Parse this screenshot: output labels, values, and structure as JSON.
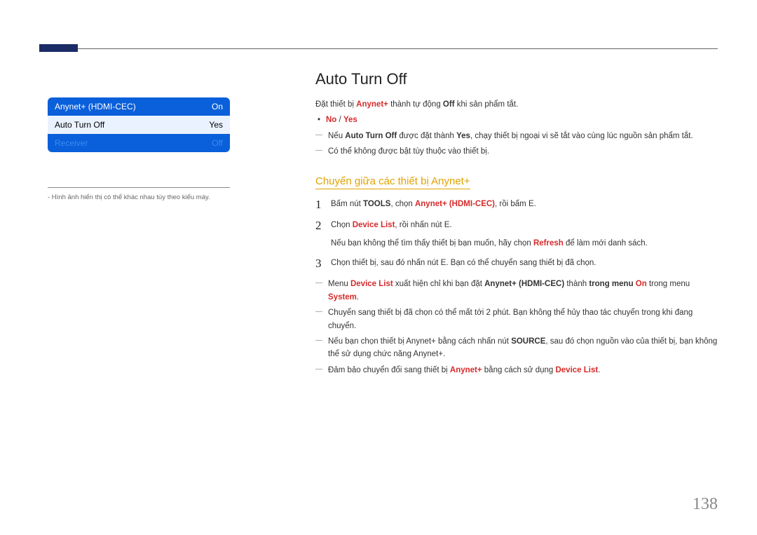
{
  "menu": {
    "row1": {
      "label": "Anynet+ (HDMI-CEC)",
      "value": "On"
    },
    "row2": {
      "label": "Auto Turn Off",
      "value": "Yes"
    },
    "row3": {
      "label": "Receiver",
      "value": "Off"
    }
  },
  "footnote": "- Hình ảnh hiển thị có thể khác nhau tùy theo kiểu máy.",
  "heading": "Auto Turn Off",
  "intro": {
    "pre": "Đặt thiết bị ",
    "k1": "Anynet+",
    "mid": " thành tự động ",
    "k2": "Off",
    "post": " khi sản phẩm tắt."
  },
  "bullet1": {
    "a": "No",
    "sep": " / ",
    "b": "Yes"
  },
  "note1": {
    "pre": "Nếu ",
    "k1": "Auto Turn Off",
    "mid1": " được đặt thành ",
    "k2": "Yes",
    "post": ", chạy thiết bị ngoại vi sẽ tắt vào cùng lúc nguồn sản phẩm tắt."
  },
  "note2": "Có thể không được bật tùy thuộc vào thiết bị.",
  "h2": "Chuyển giữa các thiết bị Anynet+",
  "step1": {
    "num": "1",
    "t1": "Bấm nút ",
    "k1": "TOOLS",
    "t2": ", chọn ",
    "k2": "Anynet+ (HDMI-CEC)",
    "t3": ", rồi bấm ",
    "k3": "E",
    "t4": "."
  },
  "step2": {
    "num": "2",
    "t1": "Chọn ",
    "k1": "Device List",
    "t2": ", rồi nhấn nút ",
    "k2": "E",
    "t3": ".",
    "sub1a": "Nếu bạn không thể tìm thấy thiết bị bạn muốn, hãy chọn ",
    "sub1k": "Refresh",
    "sub1b": " để làm mới danh sách."
  },
  "step3": {
    "num": "3",
    "t1": "Chọn thiết bị, sau đó nhấn nút ",
    "k1": "E",
    "t2": ". Bạn có thể chuyển sang thiết bị đã chọn."
  },
  "bnote1": {
    "a": "Menu ",
    "k1": "Device List",
    "b": " xuất hiện chỉ khi bạn đặt ",
    "k2": "Anynet+ (HDMI-CEC)",
    "c": " thành ",
    "k3": "On",
    "d": " trong menu ",
    "k4": "System",
    "e": "."
  },
  "bnote2": "Chuyển sang thiết bị đã chọn có thể mất tới 2 phút. Bạn không thể hủy thao tác chuyển trong khi đang chuyển.",
  "bnote3": {
    "a": "Nếu bạn chọn thiết bị Anynet+ bằng cách nhấn nút ",
    "k1": "SOURCE",
    "b": ", sau đó chọn nguồn vào của thiết bị, bạn không thể sử dụng chức năng Anynet+."
  },
  "bnote4": {
    "a": "Đảm bảo chuyển đổi sang thiết bị ",
    "k1": "Anynet+",
    "b": " bằng cách sử dụng ",
    "k2": "Device List",
    "c": "."
  },
  "page_number": "138"
}
